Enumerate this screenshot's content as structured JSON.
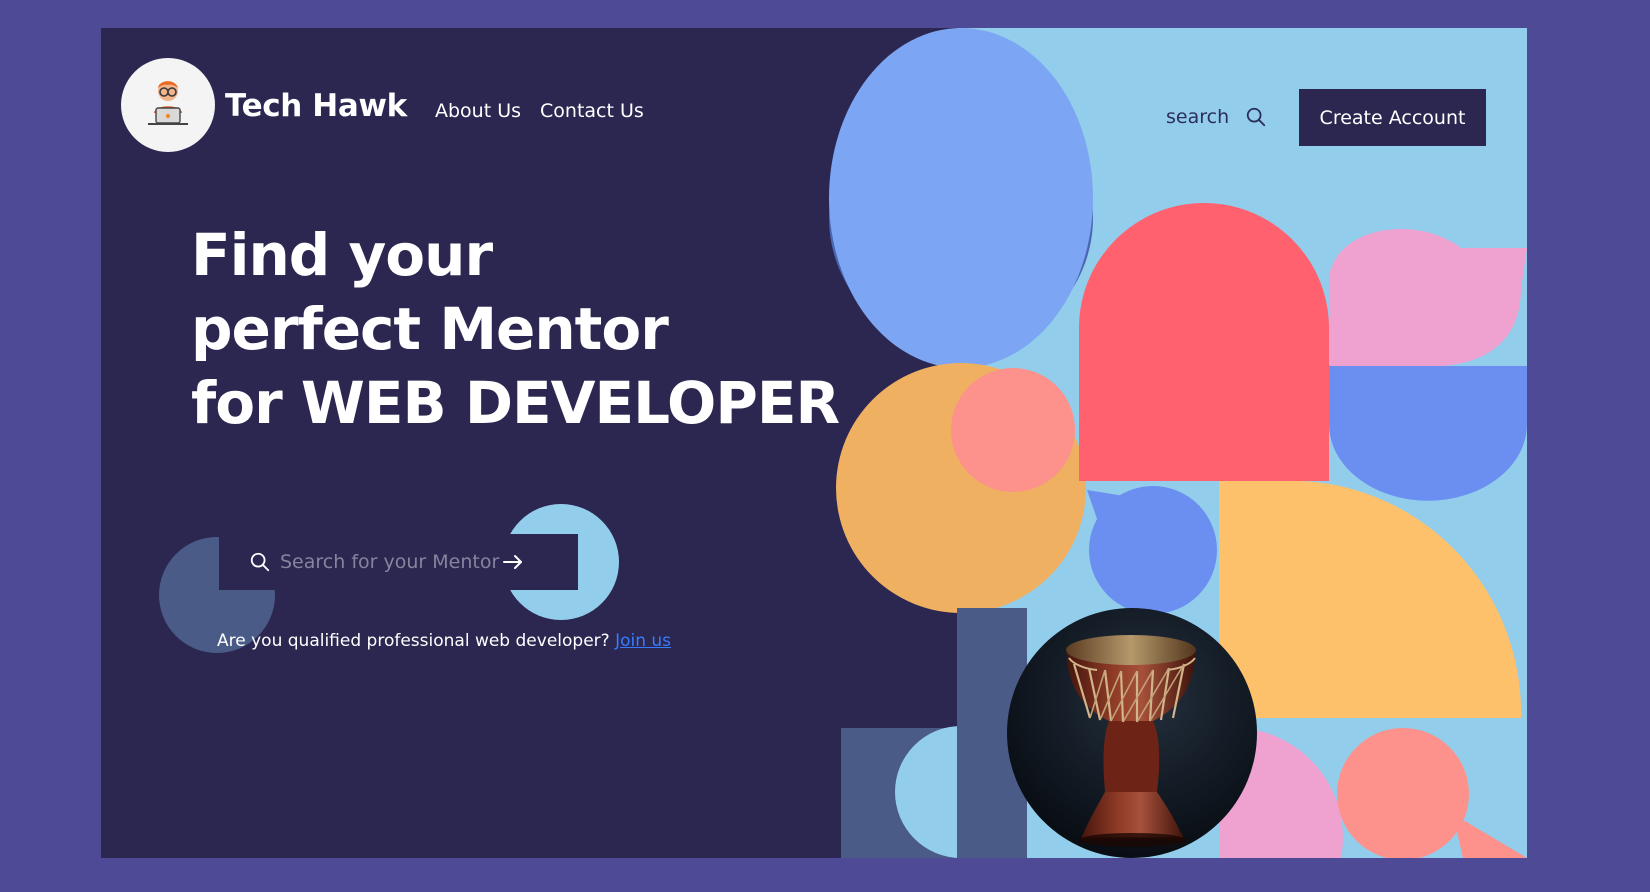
{
  "brand": {
    "name": "Tech Hawk"
  },
  "nav": {
    "items": [
      {
        "label": "About Us"
      },
      {
        "label": "Contact Us"
      }
    ]
  },
  "header": {
    "search_label": "search",
    "create_account_label": "Create Account"
  },
  "hero": {
    "line1": "Find your",
    "line2": "perfect Mentor",
    "line3": "for WEB DEVELOPER"
  },
  "search": {
    "placeholder": "Search for your Mentor"
  },
  "join": {
    "text": "Are you qualified professional web developer?",
    "link": "Join us"
  },
  "icons": {
    "logo": "developer-avatar-icon",
    "search": "search-icon",
    "arrow": "arrow-right-icon",
    "image": "djembe-drum-image"
  },
  "colors": {
    "page_background": "#4e4a95",
    "hero_background": "#2b2750",
    "panel_background": "#93cdec",
    "accent_red": "#ff616e",
    "accent_orange": "#efb061",
    "accent_blue": "#6b8ff1",
    "accent_pink": "#efa1cf",
    "accent_peach": "#fc928b"
  }
}
